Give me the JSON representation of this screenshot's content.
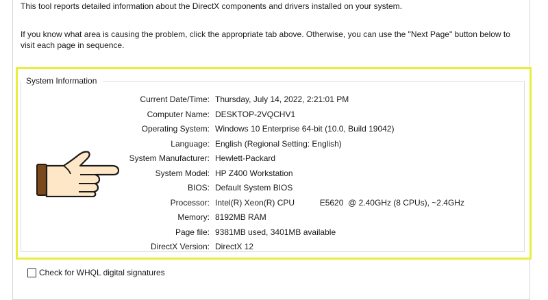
{
  "intro_text": "This tool reports detailed information about the DirectX components and drivers installed on your system.",
  "instructions_text": "If you know what area is causing the problem, click the appropriate tab above.  Otherwise, you can use the \"Next Page\" button below to visit each page in sequence.",
  "system_info": {
    "title": "System Information",
    "rows": [
      {
        "label": "Current Date/Time:",
        "value": "Thursday, July 14, 2022, 2:21:01 PM"
      },
      {
        "label": "Computer Name:",
        "value": "DESKTOP-2VQCHV1"
      },
      {
        "label": "Operating System:",
        "value": "Windows 10 Enterprise 64-bit (10.0, Build 19042)"
      },
      {
        "label": "Language:",
        "value": "English (Regional Setting: English)"
      },
      {
        "label": "System Manufacturer:",
        "value": "Hewlett-Packard"
      },
      {
        "label": "System Model:",
        "value": "HP Z400 Workstation"
      },
      {
        "label": "BIOS:",
        "value": "Default System BIOS"
      },
      {
        "label": "Processor:",
        "value": "Intel(R) Xeon(R) CPU           E5620  @ 2.40GHz (8 CPUs), ~2.4GHz"
      },
      {
        "label": "Memory:",
        "value": "8192MB RAM"
      },
      {
        "label": "Page file:",
        "value": "9381MB used, 3401MB available"
      },
      {
        "label": "DirectX Version:",
        "value": "DirectX 12"
      }
    ]
  },
  "whql_checkbox": {
    "label": "Check for WHQL digital signatures",
    "checked": false
  },
  "colors": {
    "highlight": "#e8ee3c",
    "hand_skin": "#fde7c6",
    "hand_cuff": "#7a4a1e"
  },
  "icons": {
    "pointer": "pointing-hand-icon"
  }
}
